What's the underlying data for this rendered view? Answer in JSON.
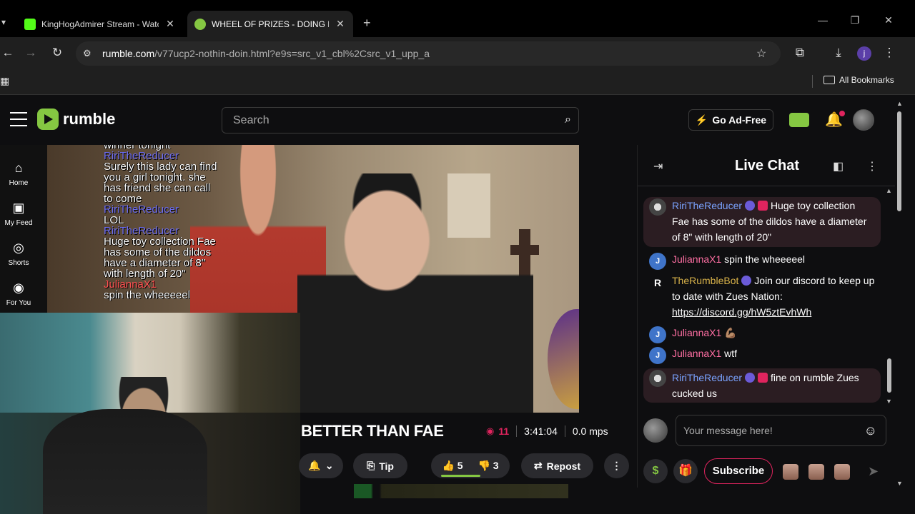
{
  "browser": {
    "tabs": [
      {
        "title": "KingHogAdmirer Stream - Watc",
        "active": false
      },
      {
        "title": "WHEEL OF PRIZES - DOING IT F",
        "active": true
      }
    ],
    "new_tab": "+",
    "url_host": "rumble.com",
    "url_rest": "/v77ucp2-nothin-doin.html?e9s=src_v1_cbl%2Csrc_v1_upp_a",
    "profile_initial": "j",
    "all_bookmarks": "All Bookmarks"
  },
  "header": {
    "logo_text": "rumble",
    "search_placeholder": "Search",
    "go_ad_free": "Go Ad-Free"
  },
  "nav": {
    "items": [
      {
        "label": "Home",
        "icon": "home-icon"
      },
      {
        "label": "My Feed",
        "icon": "feed-icon"
      },
      {
        "label": "Shorts",
        "icon": "shorts-icon"
      },
      {
        "label": "For You",
        "icon": "for-you-icon"
      }
    ]
  },
  "video": {
    "overlay_lines": [
      {
        "user": false,
        "text": "winner tonight"
      },
      {
        "user": true,
        "text": "RiriTheReducer"
      },
      {
        "user": false,
        "text": "Surely this lady can find you a girl tonight. she has friend she can call to come"
      },
      {
        "user": true,
        "text": "RiriTheReducer"
      },
      {
        "user": false,
        "text": "LOL"
      },
      {
        "user": true,
        "text": "RiriTheReducer"
      },
      {
        "user": false,
        "text": "Huge toy collection Fae has some of the dildos have a diameter of 8\" with length of 20\""
      },
      {
        "user": true,
        "text": "JuliannaX1",
        "alt": true
      },
      {
        "user": false,
        "text": "spin the wheeeeel"
      }
    ],
    "title": "BETTER THAN FAE",
    "viewers": "11",
    "duration": "3:41:04",
    "mps": "0.0 mps",
    "tip_label": "Tip",
    "likes": "5",
    "dislikes": "3",
    "repost_label": "Repost"
  },
  "chat": {
    "title": "Live Chat",
    "messages": [
      {
        "user": "RiriTheReducer",
        "text": "Huge toy collection Fae has some of the dildos have a diameter of 8\" with length of 20\"",
        "highlight": true
      },
      {
        "user": "JuliannaX1",
        "avatar": "J",
        "text": "spin the wheeeeel"
      },
      {
        "user": "TheRumbleBot",
        "avatar": "R",
        "text": "Join our discord to keep up to date with Zues Nation: ",
        "link": "https://discord.gg/hW5ztEvhWh"
      },
      {
        "user": "JuliannaX1",
        "avatar": "J",
        "text": "💪🏽"
      },
      {
        "user": "JuliannaX1",
        "avatar": "J",
        "text": "wtf"
      },
      {
        "user": "RiriTheReducer",
        "text": "fine on rumble Zues cucked us",
        "highlight": true
      }
    ],
    "input_placeholder": "Your message here!",
    "dollar": "$",
    "subscribe": "Subscribe"
  },
  "colors": {
    "brand": "#85c742",
    "live_red": "#e0245e",
    "chat_user_blue": "#7aa3ff",
    "chat_user_pink": "#ff6fa3"
  }
}
